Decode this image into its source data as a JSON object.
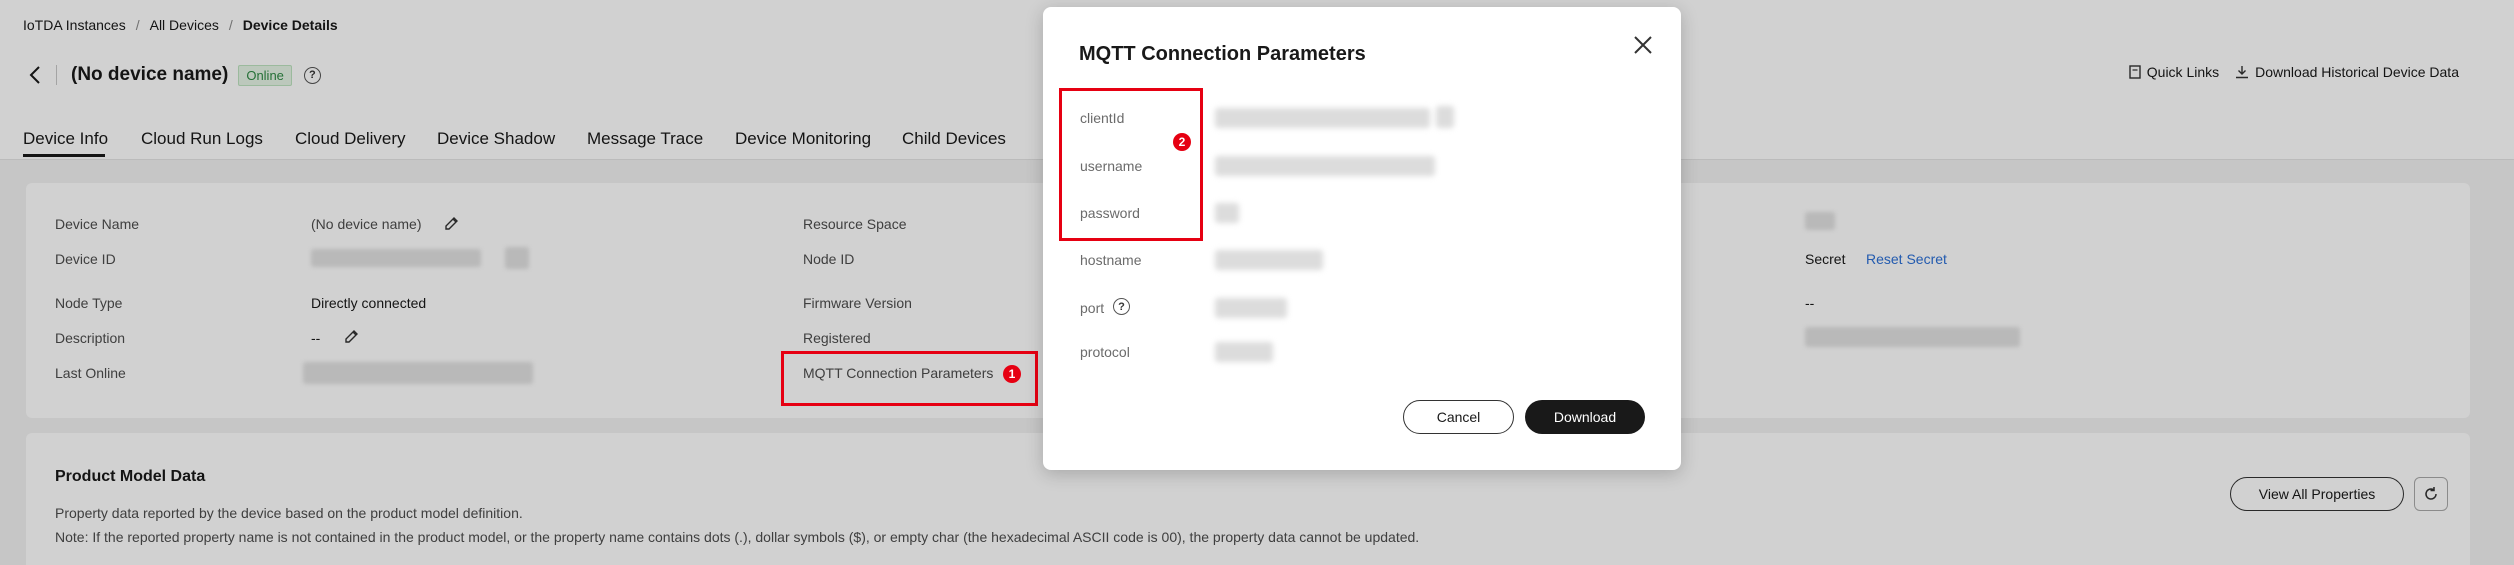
{
  "breadcrumb": {
    "item1": "IoTDA Instances",
    "item2": "All Devices",
    "current": "Device Details",
    "sep": "/"
  },
  "header": {
    "title": "(No device name)",
    "status": "Online",
    "help": "?",
    "quick_links": "Quick Links",
    "download_history": "Download Historical Device Data"
  },
  "tabs": [
    "Device Info",
    "Cloud Run Logs",
    "Cloud Delivery",
    "Device Shadow",
    "Message Trace",
    "Device Monitoring",
    "Child Devices"
  ],
  "info": {
    "device_name_label": "Device Name",
    "device_name_value": "(No device name)",
    "device_id_label": "Device ID",
    "node_type_label": "Node Type",
    "node_type_value": "Directly connected",
    "description_label": "Description",
    "description_value": "--",
    "last_online_label": "Last Online",
    "resource_space_label": "Resource Space",
    "node_id_label": "Node ID",
    "firmware_label": "Firmware Version",
    "registered_label": "Registered",
    "mqtt_label": "MQTT Connection Parameters",
    "secret_label": "Secret",
    "reset_secret": "Reset Secret",
    "right_dash": "--"
  },
  "product_model": {
    "title": "Product Model Data",
    "desc": "Property data reported by the device based on the product model definition.",
    "note": "Note: If the reported property name is not contained in the product model, or the property name contains dots (.), dollar symbols ($), or empty char (the hexadecimal ASCII code is 00), the property data cannot be updated.",
    "view_all": "View All Properties"
  },
  "modal": {
    "title": "MQTT Connection Parameters",
    "fields": [
      "clientId",
      "username",
      "password",
      "hostname",
      "port",
      "protocol"
    ],
    "port_help": "?",
    "cancel": "Cancel",
    "download": "Download"
  },
  "markers": {
    "one": "1",
    "two": "2"
  },
  "colors": {
    "annotation_red": "#e60012",
    "online_green": "#2f8a44",
    "link_blue": "#2b6fd6",
    "primary_button": "#191919"
  }
}
